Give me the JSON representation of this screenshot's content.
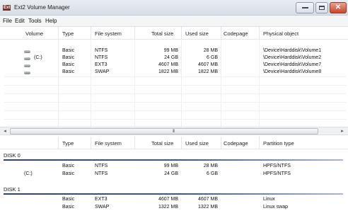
{
  "window": {
    "app_icon_text": "Ext",
    "title": "Ext2 Volume Manager"
  },
  "menu": [
    "File",
    "Edit",
    "Tools",
    "Help"
  ],
  "volumes_table": {
    "columns": [
      "Volume",
      "Type",
      "File system",
      "Total size",
      "Used size",
      "Codepage",
      "Physical object"
    ],
    "rows": [
      {
        "volume": "",
        "type": "Basic",
        "fs": "NTFS",
        "total": "99 MB",
        "used": "28 MB",
        "codepage": "",
        "physical": "\\Device\\Harddisk\\Volume1"
      },
      {
        "volume": "(C:)",
        "type": "Basic",
        "fs": "NTFS",
        "total": "24 GB",
        "used": "6 GB",
        "codepage": "",
        "physical": "\\Device\\Harddisk\\Volume2"
      },
      {
        "volume": "",
        "type": "Basic",
        "fs": "EXT3",
        "total": "4607 MB",
        "used": "4607 MB",
        "codepage": "",
        "physical": "\\Device\\Harddisk\\Volume7"
      },
      {
        "volume": "",
        "type": "Basic",
        "fs": "SWAP",
        "total": "1822 MB",
        "used": "1822 MB",
        "codepage": "",
        "physical": "\\Device\\Harddisk\\Volume8"
      }
    ]
  },
  "scrollbar": {
    "grip": "III"
  },
  "partitions_table": {
    "columns": [
      "Type",
      "File system",
      "Total size",
      "Used size",
      "Codepage",
      "Partition type"
    ],
    "disks": [
      {
        "label": "DISK 0",
        "rows": [
          {
            "volume": "",
            "type": "Basic",
            "fs": "NTFS",
            "total": "99 MB",
            "used": "28 MB",
            "codepage": "",
            "ptype": "HPFS/NTFS"
          },
          {
            "volume": "(C:)",
            "type": "Basic",
            "fs": "NTFS",
            "total": "24 GB",
            "used": "6 GB",
            "codepage": "",
            "ptype": "HPFS/NTFS"
          }
        ]
      },
      {
        "label": "DISK 1",
        "rows": [
          {
            "volume": "",
            "type": "Basic",
            "fs": "EXT3",
            "total": "4607 MB",
            "used": "4607 MB",
            "codepage": "",
            "ptype": "Linux"
          },
          {
            "volume": "",
            "type": "Basic",
            "fs": "SWAP",
            "total": "1322 MB",
            "used": "1322 MB",
            "codepage": "",
            "ptype": "Linux swap"
          }
        ]
      }
    ]
  },
  "colors": {
    "disk_rule": "#2b3f8f",
    "close_button": "#c8462c"
  },
  "icons": [
    "drive-icon",
    "minimize-icon",
    "maximize-icon",
    "close-icon",
    "scroll-left-icon",
    "scroll-right-icon"
  ]
}
